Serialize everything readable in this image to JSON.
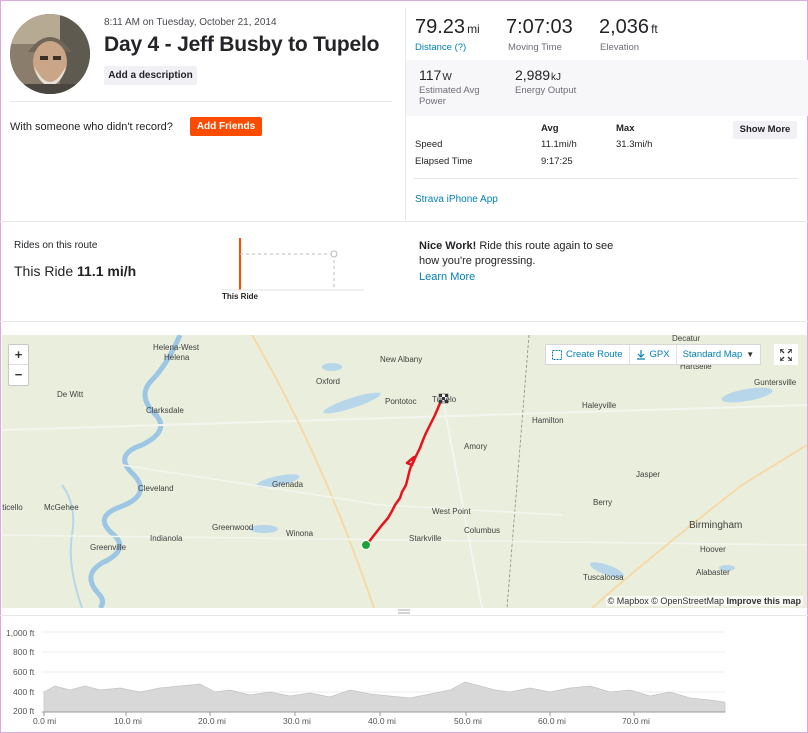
{
  "activity": {
    "datetime": "8:11 AM on Tuesday, October 21, 2014",
    "title": "Day 4 - Jeff Busby to Tupelo",
    "add_description_label": "Add a description",
    "with_someone_text": "With someone who didn't record?",
    "add_friends_label": "Add Friends"
  },
  "stats": {
    "distance": {
      "value": "79.23",
      "unit": "mi",
      "label": "Distance (?)"
    },
    "moving_time": {
      "value": "7:07:03",
      "label": "Moving Time"
    },
    "elevation": {
      "value": "2,036",
      "unit": "ft",
      "label": "Elevation"
    },
    "power": {
      "value": "117",
      "unit": "W",
      "label_line1": "Estimated Avg",
      "label_line2": "Power"
    },
    "energy": {
      "value": "2,989",
      "unit": "kJ",
      "label": "Energy Output"
    }
  },
  "details_table": {
    "col_avg": "Avg",
    "col_max": "Max",
    "rows": [
      {
        "label": "Speed",
        "avg": "11.1mi/h",
        "max": "31.3mi/h"
      },
      {
        "label": "Elapsed Time",
        "avg": "9:17:25",
        "max": ""
      }
    ],
    "show_more_label": "Show More"
  },
  "device": "Strava iPhone App",
  "route_compare": {
    "heading": "Rides on this route",
    "this_ride_prefix": "This Ride",
    "this_ride_speed": "11.1 mi/h",
    "chart_label": "This Ride",
    "nice_work_bold": "Nice Work!",
    "nice_work_text": " Ride this route again to see how you're progressing.",
    "learn_more": "Learn More"
  },
  "map": {
    "zoom_in": "+",
    "zoom_out": "−",
    "create_route": "Create Route",
    "gpx": "GPX",
    "map_style": "Standard Map",
    "attribution_mapbox": "© Mapbox",
    "attribution_osm": "© OpenStreetMap",
    "improve": "Improve this map",
    "colors": {
      "route": "#e8141b",
      "start": "#1fa23a",
      "land": "#e9efdc"
    },
    "towns": [
      {
        "name": "Helena-West",
        "cls": ""
      },
      {
        "name": "Helena",
        "cls": ""
      },
      {
        "name": "De Witt",
        "cls": ""
      },
      {
        "name": "Clarksdale",
        "cls": ""
      },
      {
        "name": "Oxford",
        "cls": ""
      },
      {
        "name": "New Albany",
        "cls": ""
      },
      {
        "name": "Pontotoc",
        "cls": ""
      },
      {
        "name": "Tupelo",
        "cls": ""
      },
      {
        "name": "Decatur",
        "cls": ""
      },
      {
        "name": "Hartselle",
        "cls": ""
      },
      {
        "name": "Guntersville",
        "cls": ""
      },
      {
        "name": "Haleyville",
        "cls": ""
      },
      {
        "name": "Hamilton",
        "cls": ""
      },
      {
        "name": "Amory",
        "cls": ""
      },
      {
        "name": "Jasper",
        "cls": ""
      },
      {
        "name": "Grenada",
        "cls": ""
      },
      {
        "name": "Cleveland",
        "cls": ""
      },
      {
        "name": "McGehee",
        "cls": ""
      },
      {
        "name": "tticello",
        "cls": ""
      },
      {
        "name": "Indianola",
        "cls": ""
      },
      {
        "name": "Greenville",
        "cls": ""
      },
      {
        "name": "Greenwood",
        "cls": ""
      },
      {
        "name": "Winona",
        "cls": ""
      },
      {
        "name": "West Point",
        "cls": ""
      },
      {
        "name": "Columbus",
        "cls": ""
      },
      {
        "name": "Starkville",
        "cls": ""
      },
      {
        "name": "Berry",
        "cls": ""
      },
      {
        "name": "Birmingham",
        "cls": "big"
      },
      {
        "name": "Hoover",
        "cls": ""
      },
      {
        "name": "Alabaster",
        "cls": ""
      },
      {
        "name": "Tuscaloosa",
        "cls": ""
      }
    ]
  },
  "elevation_chart": {
    "y_ticks": [
      "1,000 ft",
      "800 ft",
      "600 ft",
      "400 ft",
      "200 ft"
    ],
    "x_ticks": [
      "0.0 mi",
      "10.0 mi",
      "20.0 mi",
      "30.0 mi",
      "40.0 mi",
      "50.0 mi",
      "60.0 mi",
      "70.0 mi"
    ],
    "fill": "#d8d8d8"
  }
}
